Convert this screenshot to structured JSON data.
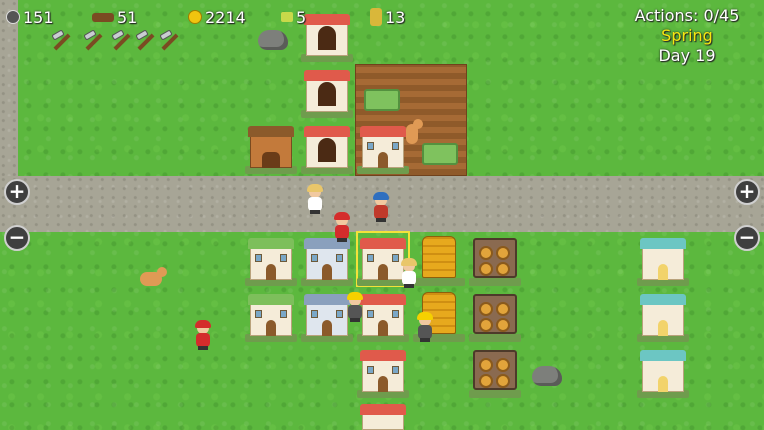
{
  "hud": {
    "stone": "151",
    "wood": "51",
    "gold": "2214",
    "cloth": "5",
    "crop": "13",
    "actions": "Actions: 0/45",
    "season": "Spring",
    "day": "Day 19"
  },
  "controls": {
    "zoom_in": "+",
    "zoom_out": "−"
  },
  "icons": {
    "stone": "stone-icon",
    "wood": "wood-log-icon",
    "gold": "gold-coin-icon",
    "cloth": "cloth-icon",
    "crop": "wheat-icon"
  },
  "colors": {
    "grass": "#5cb83e",
    "road": "#a7a596",
    "season": "#f5e60f",
    "hud_text": "#ffffff",
    "selection": "#f3e23a"
  }
}
